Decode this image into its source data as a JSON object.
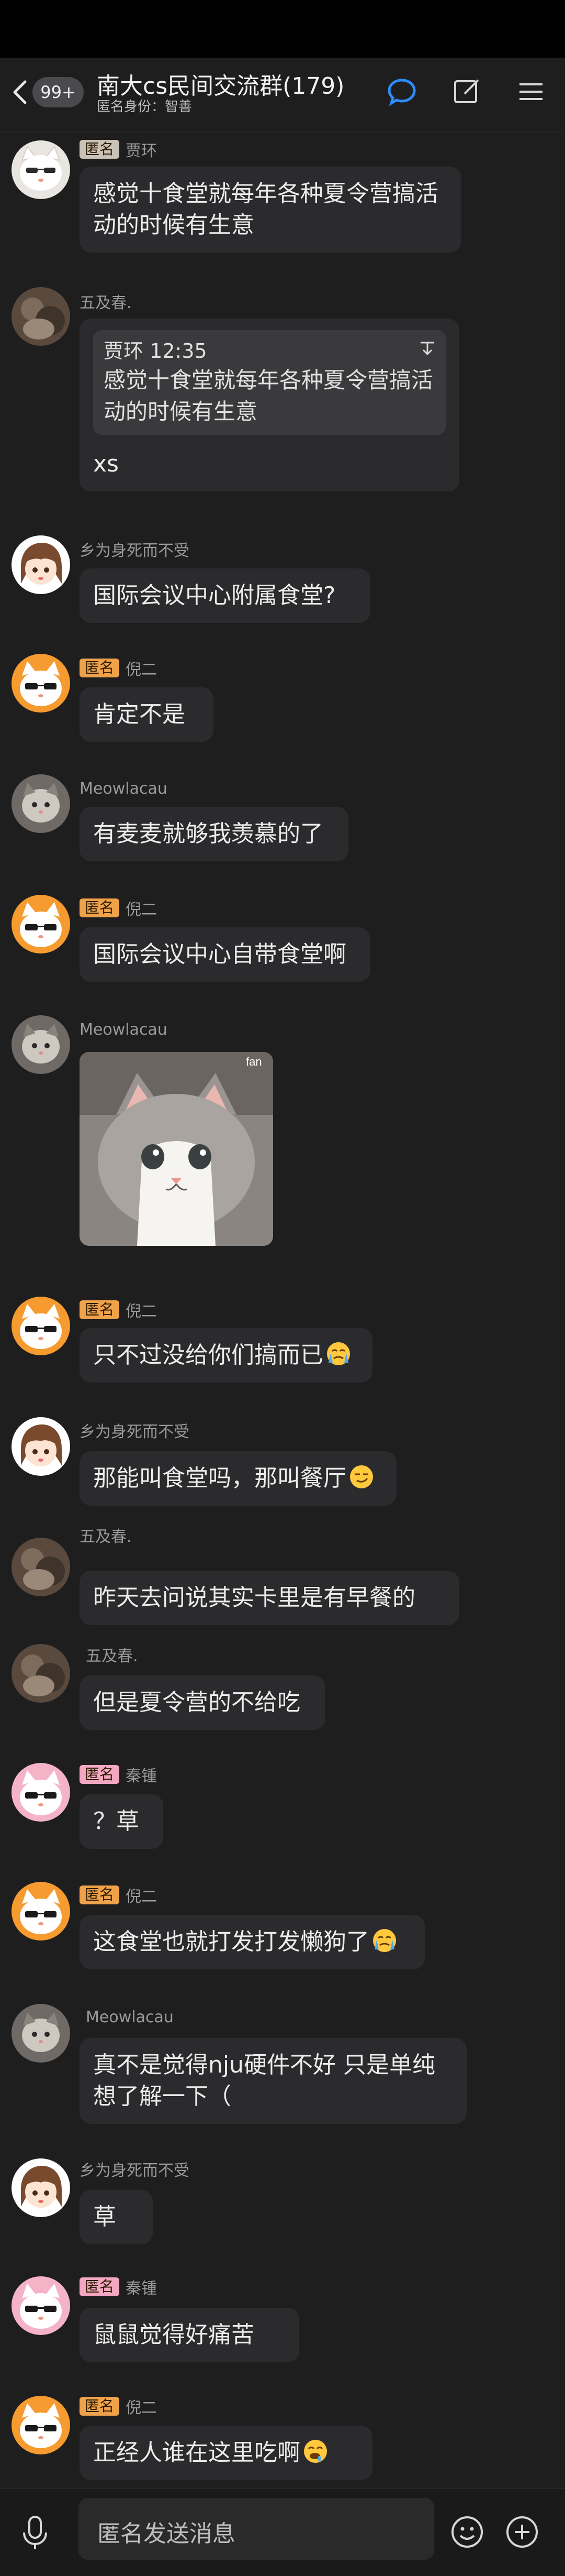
{
  "header": {
    "unread_count": "99+",
    "title": "南大cs民间交流群(179)",
    "subtitle": "匿名身份：智善"
  },
  "messages": [
    {
      "tag": "匿名",
      "sender": "贾环",
      "text": "感觉十食堂就每年各种夏令营搞活动的时候有生意"
    },
    {
      "sender": "五及春.",
      "quote_header": "贾环 12:35",
      "quote_text": "感觉十食堂就每年各种夏令营搞活动的时候有生意",
      "text": "xs"
    },
    {
      "sender": "乡为身死而不受",
      "text": "国际会议中心附属食堂?"
    },
    {
      "tag": "匿名",
      "sender": "倪二",
      "text": "肯定不是"
    },
    {
      "sender": "Meowlacau",
      "text": "有麦麦就够我羡慕的了"
    },
    {
      "tag": "匿名",
      "sender": "倪二",
      "text": "国际会议中心自带食堂啊"
    },
    {
      "sender": "Meowlacau",
      "sticker_text": "fan"
    },
    {
      "tag": "匿名",
      "sender": "倪二",
      "text": "只不过没给你们搞而已"
    },
    {
      "sender": "乡为身死而不受",
      "text": "那能叫食堂吗，那叫餐厅"
    },
    {
      "sender": "五及春.",
      "text": "昨天去问说其实卡里是有早餐的"
    },
    {
      "sender": "五及春.",
      "text": "但是夏令营的不给吃"
    },
    {
      "tag": "匿名",
      "sender": "秦锺",
      "text": "？草"
    },
    {
      "tag": "匿名",
      "sender": "倪二",
      "text": "这食堂也就打发打发懒狗了"
    },
    {
      "sender": "Meowlacau",
      "text": "真不是觉得nju硬件不好 只是单纯想了解一下（"
    },
    {
      "sender": "乡为身死而不受",
      "text": "草"
    },
    {
      "tag": "匿名",
      "sender": "秦锺",
      "text": "鼠鼠觉得好痛苦"
    },
    {
      "tag": "匿名",
      "sender": "倪二",
      "text": "正经人谁在这里吃啊"
    }
  ],
  "input": {
    "placeholder": "匿名发送消息"
  },
  "icons": [
    "back-arrow-icon",
    "chat-bubble-icon",
    "edit-icon",
    "menu-icon",
    "voice-icon",
    "emoji-icon",
    "plus-icon"
  ],
  "colors": {
    "background": "#1e1e1f",
    "bubble": "#2b2b2d",
    "accent_blue": "#2d8cff"
  }
}
